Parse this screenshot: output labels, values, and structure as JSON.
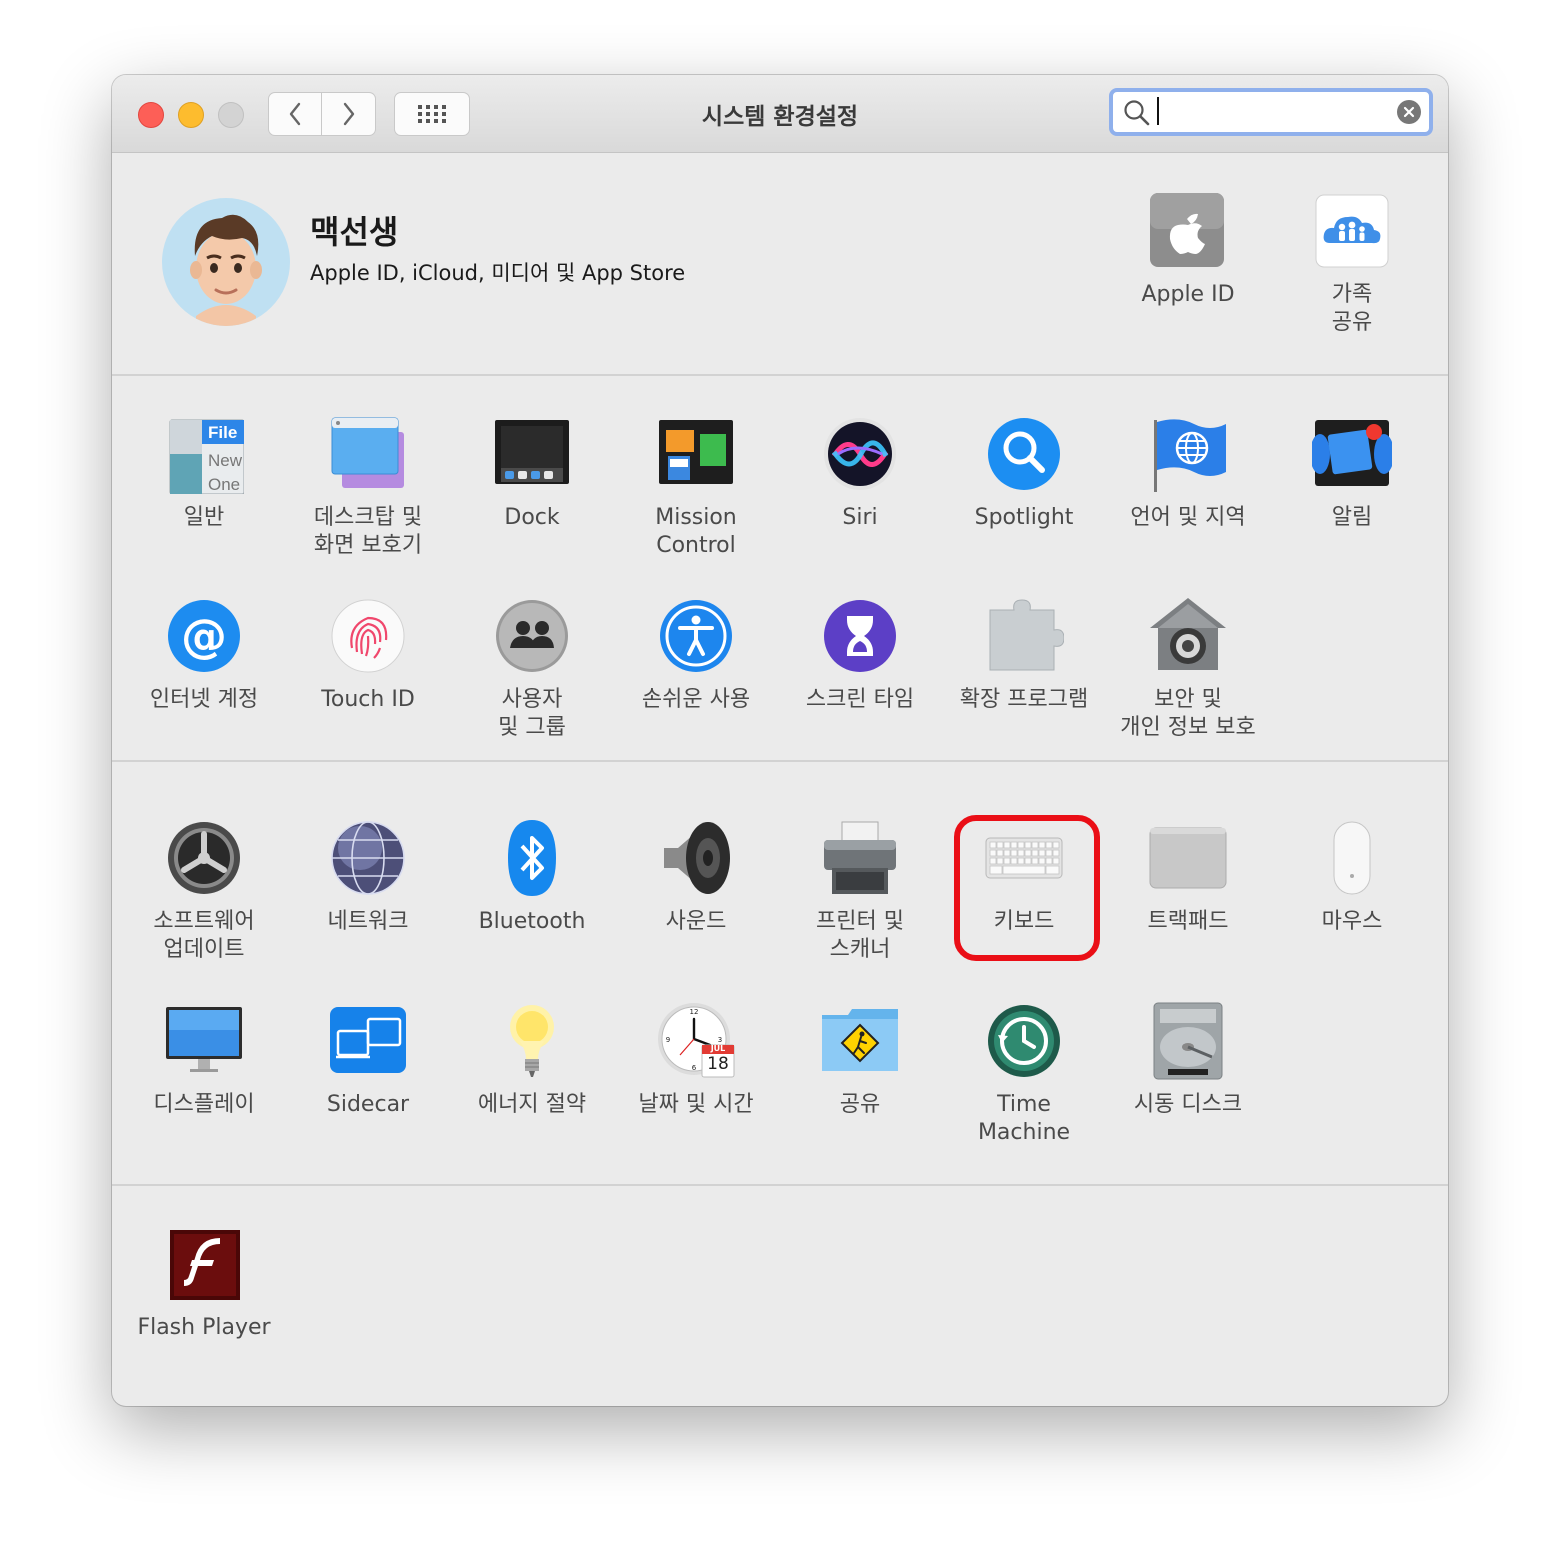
{
  "window": {
    "title": "시스템 환경설정",
    "search": {
      "value": "",
      "placeholder": ""
    }
  },
  "user": {
    "name": "맥선생",
    "subtitle": "Apple ID, iCloud, 미디어 및 App Store",
    "panes": [
      {
        "label": "Apple ID",
        "icon": "apple-logo-icon"
      },
      {
        "label": "가족\n공유",
        "icon": "family-sharing-icon"
      }
    ]
  },
  "section1": [
    {
      "label": "일반",
      "icon": "general-icon"
    },
    {
      "label": "데스크탑 및\n화면 보호기",
      "icon": "desktop-screensaver-icon"
    },
    {
      "label": "Dock",
      "icon": "dock-icon"
    },
    {
      "label": "Mission\nControl",
      "icon": "mission-control-icon"
    },
    {
      "label": "Siri",
      "icon": "siri-icon"
    },
    {
      "label": "Spotlight",
      "icon": "spotlight-icon"
    },
    {
      "label": "언어 및 지역",
      "icon": "language-region-icon"
    },
    {
      "label": "알림",
      "icon": "notifications-icon"
    },
    {
      "label": "인터넷 계정",
      "icon": "internet-accounts-icon"
    },
    {
      "label": "Touch ID",
      "icon": "touch-id-icon"
    },
    {
      "label": "사용자\n및 그룹",
      "icon": "users-groups-icon"
    },
    {
      "label": "손쉬운 사용",
      "icon": "accessibility-icon"
    },
    {
      "label": "스크린 타임",
      "icon": "screen-time-icon"
    },
    {
      "label": "확장 프로그램",
      "icon": "extensions-icon"
    },
    {
      "label": "보안 및\n개인 정보 보호",
      "icon": "security-privacy-icon"
    }
  ],
  "section2": [
    {
      "label": "소프트웨어\n업데이트",
      "icon": "software-update-icon"
    },
    {
      "label": "네트워크",
      "icon": "network-icon"
    },
    {
      "label": "Bluetooth",
      "icon": "bluetooth-icon"
    },
    {
      "label": "사운드",
      "icon": "sound-icon"
    },
    {
      "label": "프린터 및\n스캐너",
      "icon": "printers-scanners-icon"
    },
    {
      "label": "키보드",
      "icon": "keyboard-icon"
    },
    {
      "label": "트랙패드",
      "icon": "trackpad-icon"
    },
    {
      "label": "마우스",
      "icon": "mouse-icon"
    },
    {
      "label": "디스플레이",
      "icon": "displays-icon"
    },
    {
      "label": "Sidecar",
      "icon": "sidecar-icon"
    },
    {
      "label": "에너지 절약",
      "icon": "energy-saver-icon"
    },
    {
      "label": "날짜 및 시간",
      "icon": "date-time-icon"
    },
    {
      "label": "공유",
      "icon": "sharing-icon"
    },
    {
      "label": "Time\nMachine",
      "icon": "time-machine-icon"
    },
    {
      "label": "시동 디스크",
      "icon": "startup-disk-icon"
    }
  ],
  "section3": [
    {
      "label": "Flash Player",
      "icon": "flash-player-icon"
    }
  ],
  "calendar_icon": {
    "month": "JUL",
    "day": "18"
  },
  "colors": {
    "highlight": "#ea0e16",
    "search_focus": "#8fb0ec"
  }
}
